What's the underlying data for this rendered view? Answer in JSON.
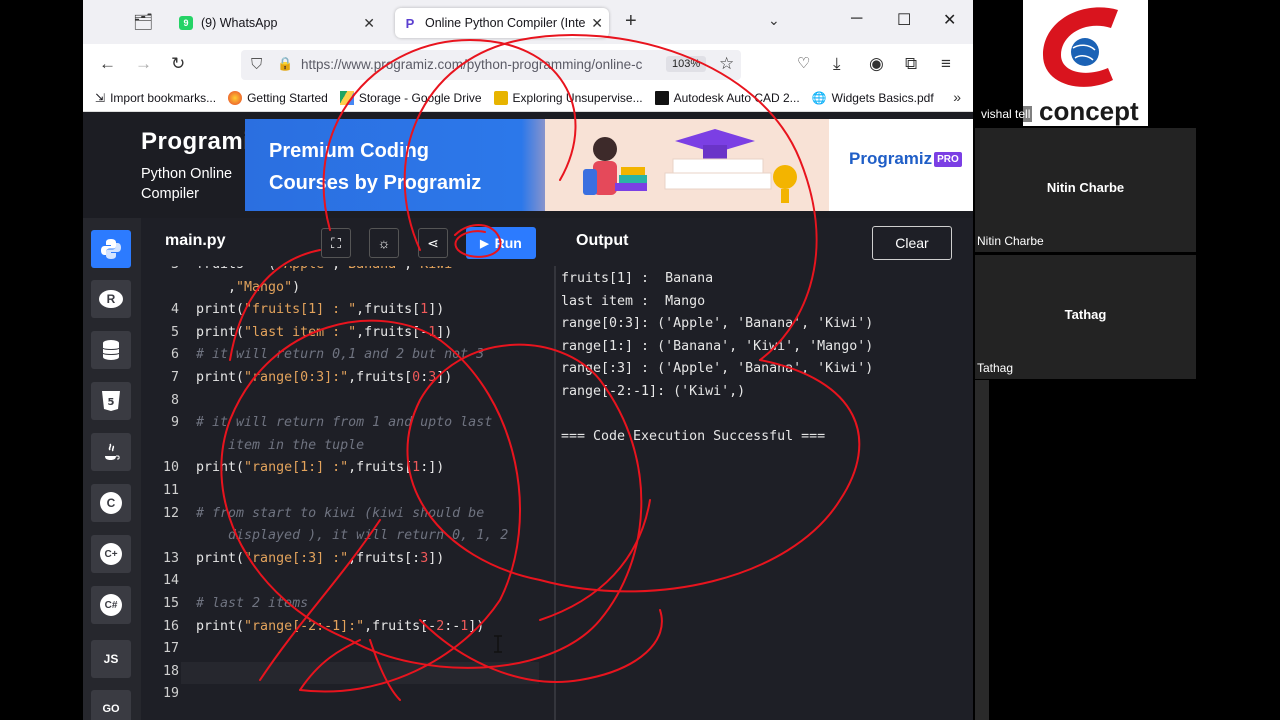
{
  "browser": {
    "tabs": [
      {
        "label": "(9) WhatsApp",
        "active": false
      },
      {
        "label": "Online Python Compiler (Inter",
        "active": true
      }
    ],
    "url": "https://www.programiz.com/python-programming/online-c",
    "zoom": "103%",
    "bookmarks": [
      "Import bookmarks...",
      "Getting Started",
      "Storage - Google Drive",
      "Exploring Unsupervise...",
      "Autodesk Auto CAD 2...",
      "Widgets Basics.pdf"
    ]
  },
  "site": {
    "logo": "Programiz",
    "subtitle": "Python Online Compiler",
    "banner": {
      "line1": "Premium Coding",
      "line2": "Courses by Programiz",
      "brand": "Programiz",
      "brand_badge": "PRO"
    }
  },
  "sidebar": {
    "languages": [
      "Python",
      "R",
      "SQL",
      "HTML",
      "Java",
      "C",
      "C++",
      "C#",
      "JS",
      "Go"
    ]
  },
  "editor": {
    "filename": "main.py",
    "run_label": "Run",
    "lines": [
      {
        "n": "3",
        "text": "fruits = (\"Apple\",\"Banana\",\"Kiwi\""
      },
      {
        "n": "",
        "text": "    ,\"Mango\")"
      },
      {
        "n": "4",
        "text": "print(\"fruits[1] : \",fruits[1])"
      },
      {
        "n": "5",
        "text": "print(\"last item : \",fruits[-1])"
      },
      {
        "n": "6",
        "text": "# it will return 0,1 and 2 but not 3"
      },
      {
        "n": "7",
        "text": "print(\"range[0:3]:\",fruits[0:3])"
      },
      {
        "n": "8",
        "text": ""
      },
      {
        "n": "9",
        "text": "# it will return from 1 and upto last"
      },
      {
        "n": "",
        "text": "    item in the tuple"
      },
      {
        "n": "10",
        "text": "print(\"range[1:] :\",fruits[1:])"
      },
      {
        "n": "11",
        "text": ""
      },
      {
        "n": "12",
        "text": "# from start to kiwi (kiwi should be"
      },
      {
        "n": "",
        "text": "    displayed ), it will return 0, 1, 2"
      },
      {
        "n": "13",
        "text": "print(\"range[:3] :\",fruits[:3])"
      },
      {
        "n": "14",
        "text": ""
      },
      {
        "n": "15",
        "text": "# last 2 items"
      },
      {
        "n": "16",
        "text": "print(\"range[-2:-1]:\",fruits[-2:-1])"
      },
      {
        "n": "17",
        "text": ""
      },
      {
        "n": "18",
        "text": ""
      },
      {
        "n": "19",
        "text": ""
      }
    ]
  },
  "output": {
    "title": "Output",
    "clear_label": "Clear",
    "lines": [
      "fruits[1] :  Banana",
      "last item :  Mango",
      "range[0:3]: ('Apple', 'Banana', 'Kiwi')",
      "range[1:] : ('Banana', 'Kiwi', 'Mango')",
      "range[:3] : ('Apple', 'Banana', 'Kiwi')",
      "range[-2:-1]: ('Kiwi',)",
      "",
      "=== Code Execution Successful ==="
    ]
  },
  "meeting": {
    "logo_text": "concept",
    "participants": [
      {
        "tile_label": "vishal tell"
      },
      {
        "center": "Nitin Charbe",
        "corner": "Nitin Charbe"
      },
      {
        "center": "Tathag",
        "corner": "Tathag"
      }
    ]
  },
  "colors": {
    "accent": "#2c7bff",
    "editor_bg": "#1e1f26",
    "annotation": "#e8141e"
  }
}
